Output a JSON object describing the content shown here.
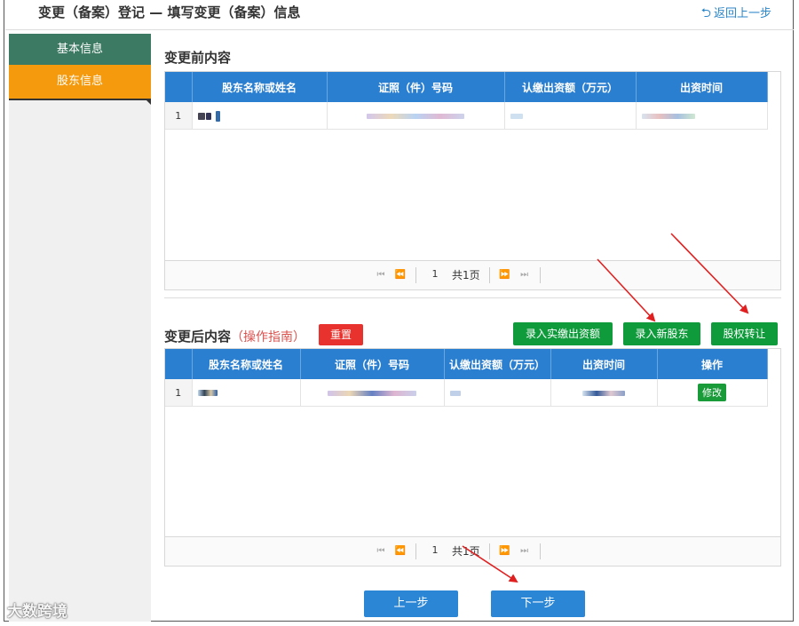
{
  "header": {
    "title": "变更（备案）登记 — 填写变更（备案）信息",
    "back_label": "返回上一步",
    "back_icon": "undo-arrow-icon"
  },
  "sidebar": {
    "items": [
      {
        "label": "基本信息"
      },
      {
        "label": "股东信息"
      }
    ]
  },
  "before": {
    "title": "变更前内容",
    "columns": [
      "股东名称或姓名",
      "证照（件）号码",
      "认缴出资额（万元）",
      "出资时间"
    ],
    "rows": [
      {
        "index": "1"
      }
    ],
    "pager": {
      "page_value": "1",
      "total_label": "共1页"
    }
  },
  "after": {
    "title": "变更后内容",
    "guide": "（操作指南）",
    "reset_label": "重置",
    "btn_paid": "录入实缴出资额",
    "btn_new_holder": "录入新股东",
    "btn_transfer": "股权转让",
    "columns": [
      "股东名称或姓名",
      "证照（件）号码",
      "认缴出资额（万元）",
      "出资时间",
      "操作"
    ],
    "rows": [
      {
        "index": "1",
        "action": "修改"
      }
    ],
    "pager": {
      "page_value": "1",
      "total_label": "共1页"
    }
  },
  "footer": {
    "prev_label": "上一步",
    "next_label": "下一步"
  },
  "watermark": "大数跨境",
  "colors": {
    "accent_blue": "#2b7fd0",
    "green": "#0f9b3c",
    "red": "#e8322d",
    "orange": "#f59a0c",
    "dark_green": "#3d7a63"
  }
}
